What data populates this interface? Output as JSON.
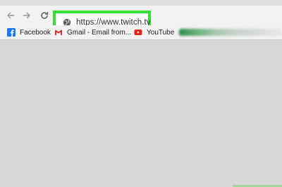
{
  "toolbar": {
    "back_icon": "arrow-left-icon",
    "forward_icon": "arrow-right-icon",
    "reload_icon": "reload-icon"
  },
  "omnibox": {
    "url": "https://www.twitch.tv",
    "site_icon": "globe-icon",
    "highlight_color": "#35e035"
  },
  "bookmarks": {
    "items": [
      {
        "label": "Facebook",
        "icon": "facebook-icon",
        "color": "#1877f2"
      },
      {
        "label": "Gmail - Email from...",
        "icon": "gmail-icon",
        "color": "#d93025"
      },
      {
        "label": "YouTube",
        "icon": "youtube-icon",
        "color": "#e62117"
      }
    ]
  },
  "colors": {
    "chrome_bg": "#f1f1f1",
    "page_bg": "#d7d7d7"
  }
}
